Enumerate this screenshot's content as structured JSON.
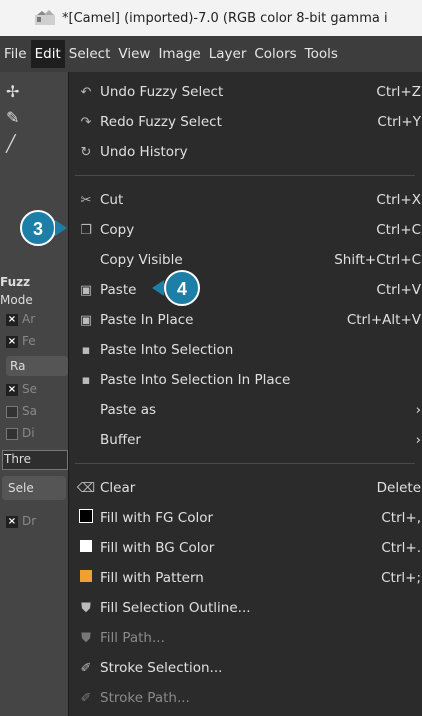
{
  "window": {
    "title": "*[Camel] (imported)-7.0 (RGB color 8-bit gamma i"
  },
  "menubar": [
    {
      "label": "File"
    },
    {
      "label": "Edit"
    },
    {
      "label": "Select"
    },
    {
      "label": "View"
    },
    {
      "label": "Image"
    },
    {
      "label": "Layer"
    },
    {
      "label": "Colors"
    },
    {
      "label": "Tools"
    }
  ],
  "toolbox": {
    "tool_label": "Fuzz",
    "mode_label": "Mode",
    "opt1": "Ar",
    "opt2": "Fe",
    "radius_btn": "Ra",
    "opt3": "Se",
    "opt4": "Sa",
    "opt5": "Di",
    "thresh": "Thre",
    "select_btn": "Sele",
    "opt6": "Dr"
  },
  "menu": {
    "undo": {
      "label": "Undo Fuzzy Select",
      "shortcut": "Ctrl+Z"
    },
    "redo": {
      "label": "Redo Fuzzy Select",
      "shortcut": "Ctrl+Y"
    },
    "undo_history": {
      "label": "Undo History"
    },
    "cut": {
      "label": "Cut",
      "shortcut": "Ctrl+X"
    },
    "copy": {
      "label": "Copy",
      "shortcut": "Ctrl+C"
    },
    "copy_visible": {
      "label": "Copy Visible",
      "shortcut": "Shift+Ctrl+C"
    },
    "paste": {
      "label": "Paste",
      "shortcut": "Ctrl+V"
    },
    "paste_in_place": {
      "label": "Paste In Place",
      "shortcut": "Ctrl+Alt+V"
    },
    "paste_into_selection": {
      "label": "Paste Into Selection"
    },
    "paste_into_selection_in_place": {
      "label": "Paste Into Selection In Place"
    },
    "paste_as": {
      "label": "Paste as",
      "arrow": "›"
    },
    "buffer": {
      "label": "Buffer",
      "arrow": "›"
    },
    "clear": {
      "label": "Clear",
      "shortcut": "Delete"
    },
    "fill_fg": {
      "label": "Fill with FG Color",
      "shortcut": "Ctrl+,"
    },
    "fill_bg": {
      "label": "Fill with BG Color",
      "shortcut": "Ctrl+."
    },
    "fill_pattern": {
      "label": "Fill with Pattern",
      "shortcut": "Ctrl+;"
    },
    "fill_selection_outline": {
      "label": "Fill Selection Outline..."
    },
    "fill_path": {
      "label": "Fill Path..."
    },
    "stroke_selection": {
      "label": "Stroke Selection..."
    },
    "stroke_path": {
      "label": "Stroke Path..."
    }
  },
  "annotations": [
    {
      "label": "3"
    },
    {
      "label": "4"
    }
  ],
  "colors": {
    "badge": "#1d7fa8",
    "fg_swatch": "#000000",
    "bg_swatch": "#ffffff",
    "pattern_swatch": "#f0a030"
  }
}
